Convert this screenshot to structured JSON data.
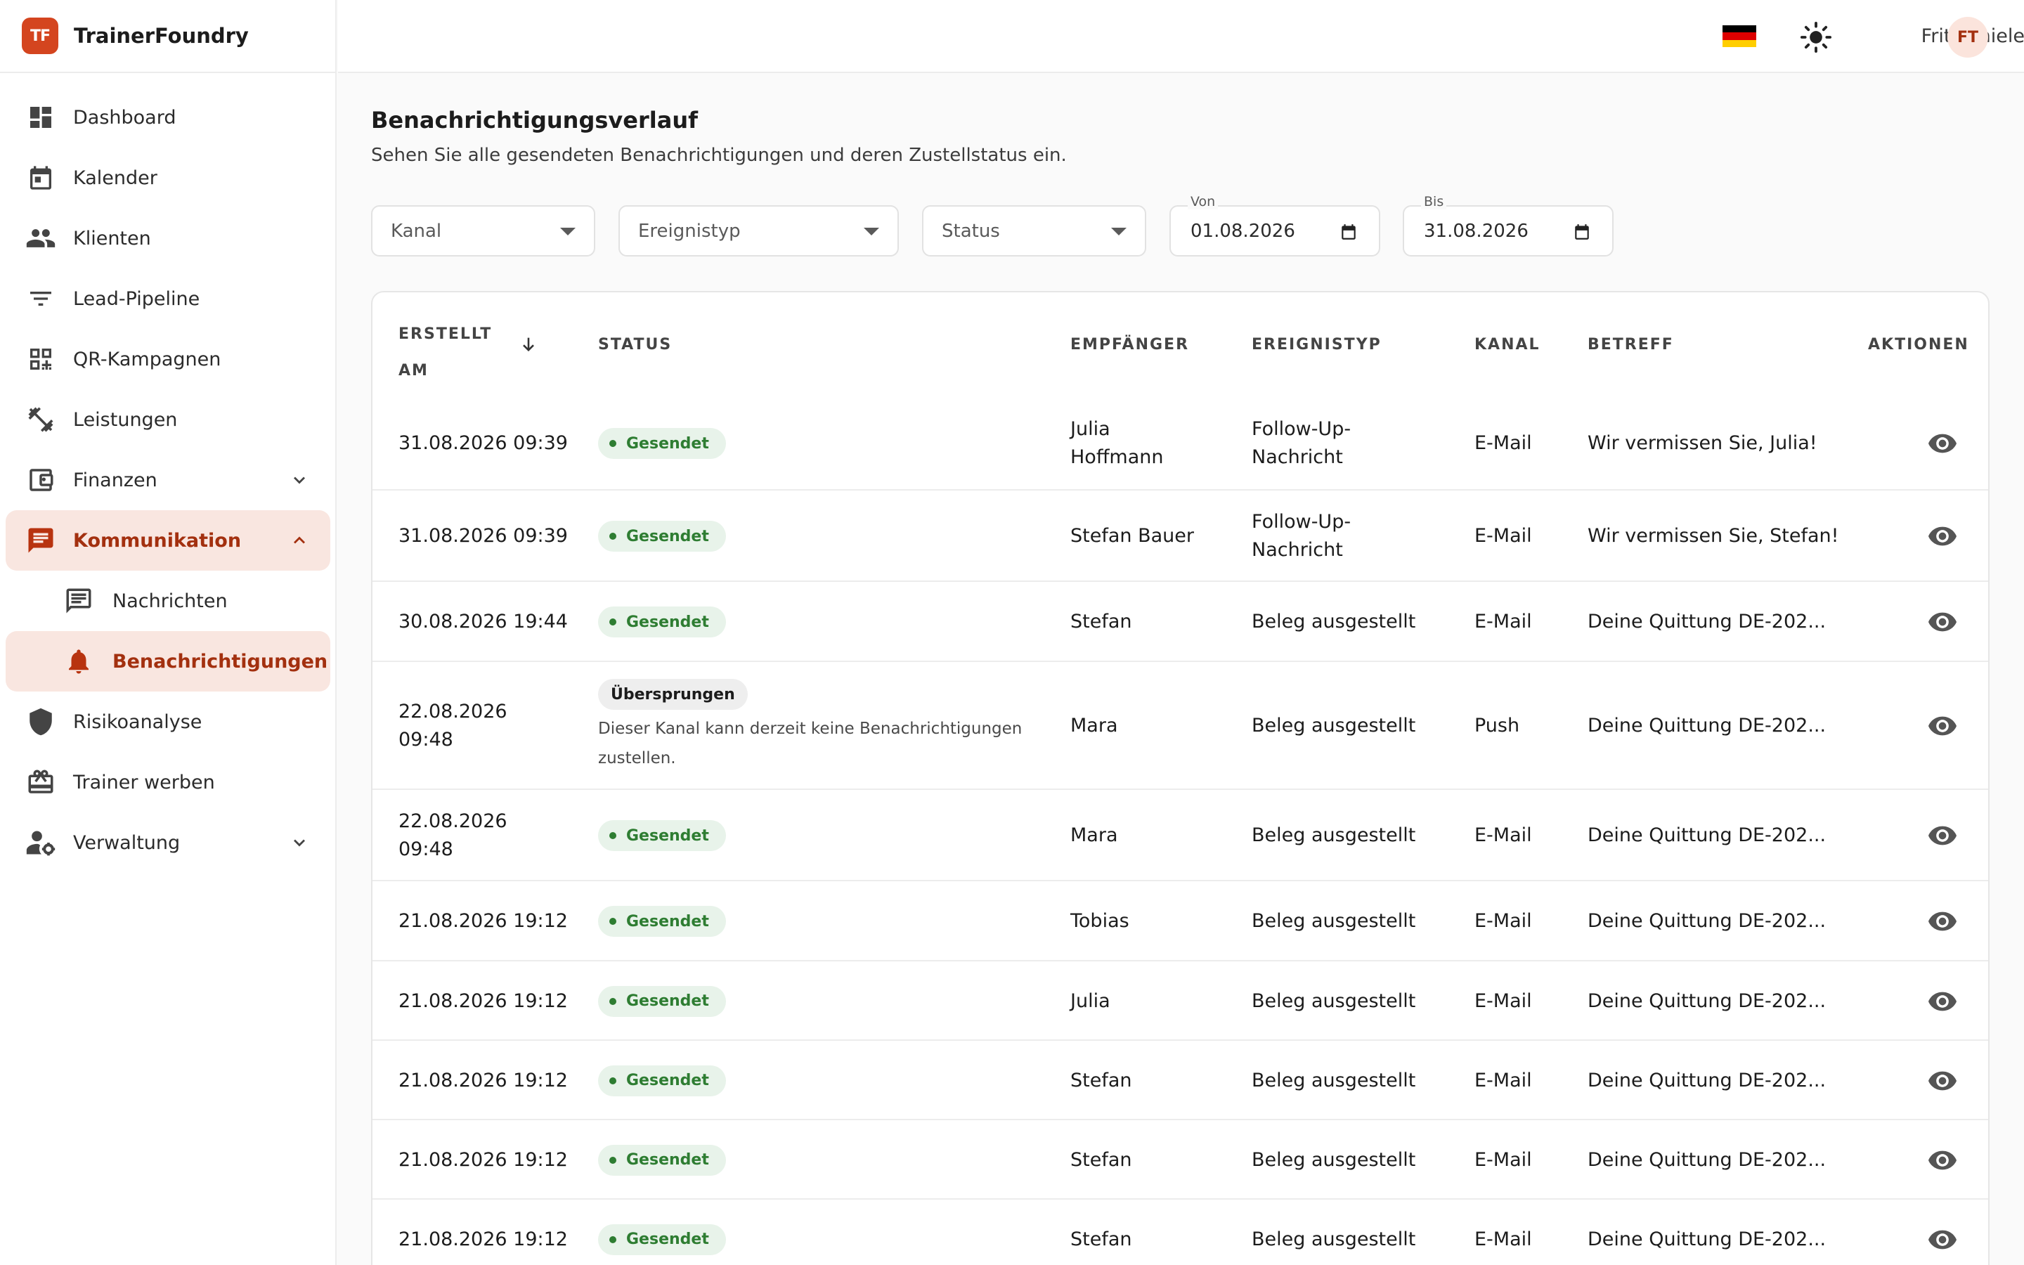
{
  "app": {
    "logo_text": "TF",
    "name": "TrainerFoundry"
  },
  "topbar": {
    "username": "Fritz Thiele",
    "avatar_initials": "FT",
    "flag_colors": [
      "#000000",
      "#dd0000",
      "#ffce00"
    ]
  },
  "sidebar": {
    "items": [
      {
        "label": "Dashboard",
        "icon": "dashboard-icon"
      },
      {
        "label": "Kalender",
        "icon": "calendar-icon"
      },
      {
        "label": "Klienten",
        "icon": "people-icon"
      },
      {
        "label": "Lead-Pipeline",
        "icon": "filter-icon"
      },
      {
        "label": "QR-Kampagnen",
        "icon": "qr-code-icon"
      },
      {
        "label": "Leistungen",
        "icon": "dumbbell-icon"
      },
      {
        "label": "Finanzen",
        "icon": "wallet-icon"
      },
      {
        "label": "Kommunikation",
        "icon": "chat-icon"
      },
      {
        "label": "Nachrichten",
        "icon": "message-icon"
      },
      {
        "label": "Benachrichtigungen",
        "icon": "bell-icon"
      },
      {
        "label": "Risikoanalyse",
        "icon": "shield-icon"
      },
      {
        "label": "Trainer werben",
        "icon": "gift-icon"
      },
      {
        "label": "Verwaltung",
        "icon": "user-gear-icon"
      }
    ]
  },
  "page": {
    "title": "Benachrichtigungsverlauf",
    "subtitle": "Sehen Sie alle gesendeten Benachrichtigungen und deren Zustellstatus ein."
  },
  "filters": {
    "channel": "Kanal",
    "event_type": "Ereignistyp",
    "status": "Status",
    "from_label": "Von",
    "from_value": "01.08.2026",
    "to_label": "Bis",
    "to_value": "31.08.2026"
  },
  "table": {
    "headers": {
      "created_line1": "ERSTELLT",
      "created_line2": "AM",
      "status": "STATUS",
      "recipient": "EMPFÄNGER",
      "event_type": "EREIGNISTYP",
      "channel": "KANAL",
      "subject": "BETREFF",
      "actions": "AKTIONEN"
    },
    "rows": [
      {
        "created_l1": "31.08.2026 09:39",
        "created_l2": "",
        "status": "Gesendet",
        "note_l1": "",
        "note_l2": "",
        "recipient_l1": "Julia",
        "recipient_l2": "Hoffmann",
        "event_l1": "Follow-Up-",
        "event_l2": "Nachricht",
        "channel": "E-Mail",
        "subject": "Wir vermissen Sie, Julia!"
      },
      {
        "created_l1": "31.08.2026 09:39",
        "created_l2": "",
        "status": "Gesendet",
        "note_l1": "",
        "note_l2": "",
        "recipient_l1": "Stefan Bauer",
        "recipient_l2": "",
        "event_l1": "Follow-Up-",
        "event_l2": "Nachricht",
        "channel": "E-Mail",
        "subject": "Wir vermissen Sie, Stefan!"
      },
      {
        "created_l1": "30.08.2026 19:44",
        "created_l2": "",
        "status": "Gesendet",
        "note_l1": "",
        "note_l2": "",
        "recipient_l1": "Stefan",
        "recipient_l2": "",
        "event_l1": "Beleg ausgestellt",
        "event_l2": "",
        "channel": "E-Mail",
        "subject": "Deine Quittung DE-202..."
      },
      {
        "created_l1": "22.08.2026",
        "created_l2": "09:48",
        "status": "Übersprungen",
        "note_l1": "Dieser Kanal kann derzeit keine Benachrichtigungen",
        "note_l2": "zustellen.",
        "recipient_l1": "Mara",
        "recipient_l2": "",
        "event_l1": "Beleg ausgestellt",
        "event_l2": "",
        "channel": "Push",
        "subject": "Deine Quittung DE-202..."
      },
      {
        "created_l1": "22.08.2026",
        "created_l2": "09:48",
        "status": "Gesendet",
        "note_l1": "",
        "note_l2": "",
        "recipient_l1": "Mara",
        "recipient_l2": "",
        "event_l1": "Beleg ausgestellt",
        "event_l2": "",
        "channel": "E-Mail",
        "subject": "Deine Quittung DE-202..."
      },
      {
        "created_l1": "21.08.2026 19:12",
        "created_l2": "",
        "status": "Gesendet",
        "note_l1": "",
        "note_l2": "",
        "recipient_l1": "Tobias",
        "recipient_l2": "",
        "event_l1": "Beleg ausgestellt",
        "event_l2": "",
        "channel": "E-Mail",
        "subject": "Deine Quittung DE-202..."
      },
      {
        "created_l1": "21.08.2026 19:12",
        "created_l2": "",
        "status": "Gesendet",
        "note_l1": "",
        "note_l2": "",
        "recipient_l1": "Julia",
        "recipient_l2": "",
        "event_l1": "Beleg ausgestellt",
        "event_l2": "",
        "channel": "E-Mail",
        "subject": "Deine Quittung DE-202..."
      },
      {
        "created_l1": "21.08.2026 19:12",
        "created_l2": "",
        "status": "Gesendet",
        "note_l1": "",
        "note_l2": "",
        "recipient_l1": "Stefan",
        "recipient_l2": "",
        "event_l1": "Beleg ausgestellt",
        "event_l2": "",
        "channel": "E-Mail",
        "subject": "Deine Quittung DE-202..."
      },
      {
        "created_l1": "21.08.2026 19:12",
        "created_l2": "",
        "status": "Gesendet",
        "note_l1": "",
        "note_l2": "",
        "recipient_l1": "Stefan",
        "recipient_l2": "",
        "event_l1": "Beleg ausgestellt",
        "event_l2": "",
        "channel": "E-Mail",
        "subject": "Deine Quittung DE-202..."
      },
      {
        "created_l1": "21.08.2026 19:12",
        "created_l2": "",
        "status": "Gesendet",
        "note_l1": "",
        "note_l2": "",
        "recipient_l1": "Stefan",
        "recipient_l2": "",
        "event_l1": "Beleg ausgestellt",
        "event_l2": "",
        "channel": "E-Mail",
        "subject": "Deine Quittung DE-202..."
      }
    ]
  },
  "colors": {
    "accent": "#d4451f",
    "active_bg": "#f9e6e0",
    "active_text": "#a3300f",
    "success": "#2e7d32",
    "success_bg": "#e8f3ea"
  }
}
